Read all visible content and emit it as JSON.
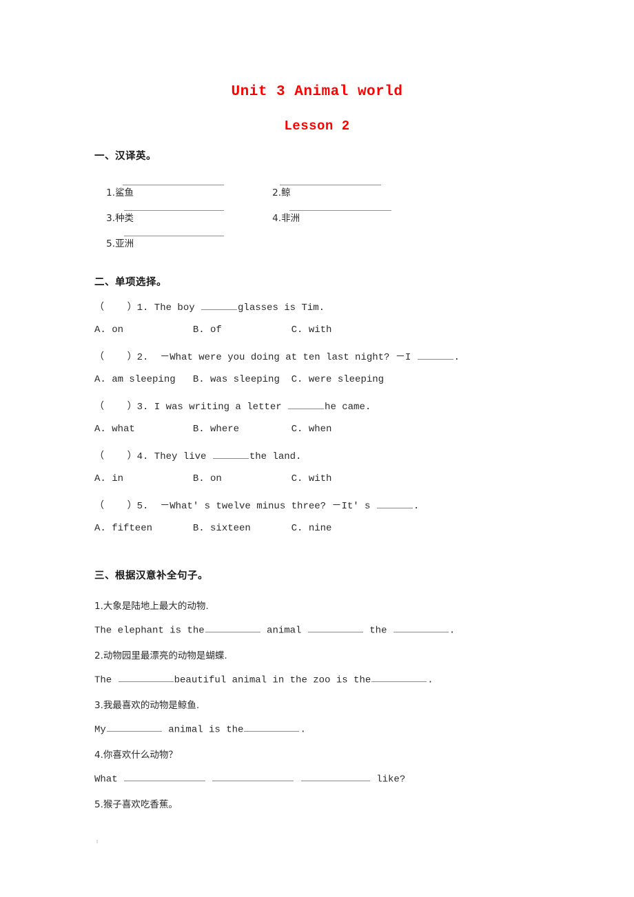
{
  "title": {
    "main": "Unit 3 Animal world",
    "sub": "Lesson 2",
    "color": "#ff0000"
  },
  "sections": [
    {
      "heading": "一、汉译英。",
      "items": [
        {
          "num": "1.",
          "word": "鲨鱼"
        },
        {
          "num": "2.",
          "word": "鲸"
        },
        {
          "num": "3.",
          "word": "种类"
        },
        {
          "num": "4.",
          "word": "非洲"
        },
        {
          "num": "5.",
          "word": "亚洲"
        }
      ]
    },
    {
      "heading": "二、单项选择。",
      "questions": [
        {
          "stem_pre": "（    ）1. The boy ",
          "stem_post": "glasses is Tim.",
          "options": "A. on            B. of            C. with"
        },
        {
          "stem_pre": "（    ）2.  －What were you doing at ten last night? －I ",
          "stem_post": ".",
          "options": "A. am sleeping   B. was sleeping  C. were sleeping"
        },
        {
          "stem_pre": "（    ）3. I was writing a letter ",
          "stem_post": "he came.",
          "options": "A. what          B. where         C. when"
        },
        {
          "stem_pre": "（    ）4. They live ",
          "stem_post": "the land.",
          "options": "A. in            B. on            C. with"
        },
        {
          "stem_pre": "（    ）5.  －What' s twelve minus three? －It' s ",
          "stem_post": ".",
          "options": "A. fifteen       B. sixteen       C. nine"
        }
      ]
    },
    {
      "heading": "三、根据汉意补全句子。",
      "items": [
        {
          "cn": "1.大象是陆地上最大的动物.",
          "en_parts": [
            "The elephant is the",
            " animal ",
            " the ",
            "."
          ]
        },
        {
          "cn": "2.动物园里最漂亮的动物是蝴蝶.",
          "en_parts": [
            "The ",
            "beautiful animal in the zoo is the",
            "."
          ]
        },
        {
          "cn": "3.我最喜欢的动物是鲸鱼.",
          "en_parts": [
            "My",
            " animal is the",
            "."
          ]
        },
        {
          "cn": "4.你喜欢什么动物？",
          "en_parts": [
            "What ",
            " ",
            " ",
            " like?"
          ]
        },
        {
          "cn": "5.猴子喜欢吃香蕉。",
          "en_parts": []
        }
      ]
    }
  ]
}
